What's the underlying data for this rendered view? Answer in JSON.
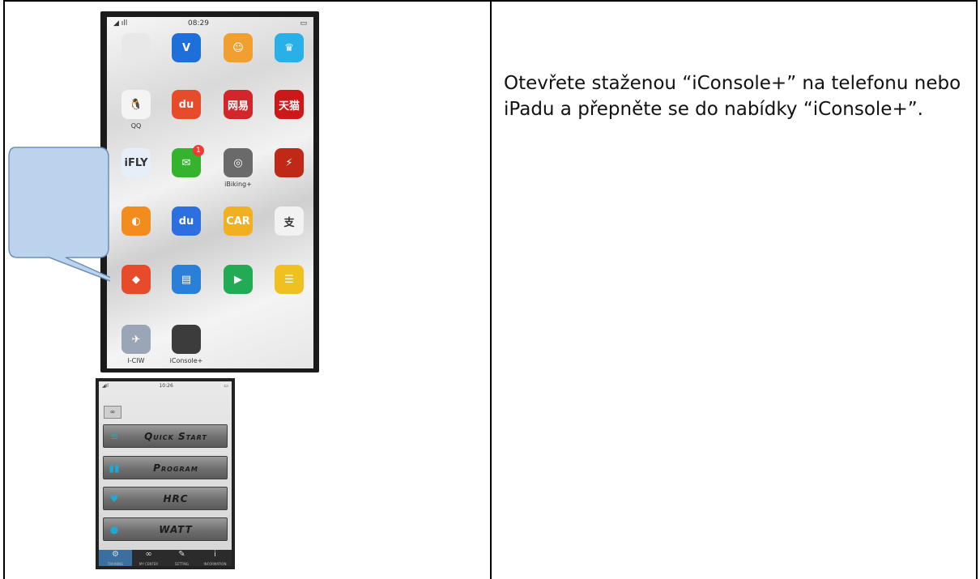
{
  "instruction": "Otevřete staženou “iConsole+” na telefonu nebo iPadu a přepněte se do nabídky “iConsole+”.",
  "phone_home": {
    "status_time": "08:29",
    "apps": [
      {
        "label": "",
        "glyph": "",
        "color": "#e8e8e8"
      },
      {
        "label": "",
        "glyph": "V",
        "color": "#1e6fd9"
      },
      {
        "label": "",
        "glyph": "☺",
        "color": "#f0a030"
      },
      {
        "label": "",
        "glyph": "♛",
        "color": "#2ab0e8"
      },
      {
        "label": "QQ",
        "glyph": "🐧",
        "color": "#f4f4f4"
      },
      {
        "label": "",
        "glyph": "du",
        "color": "#e84b2c"
      },
      {
        "label": "",
        "glyph": "网易",
        "color": "#d3262a"
      },
      {
        "label": "",
        "glyph": "天猫",
        "color": "#cc1818"
      },
      {
        "label": "",
        "glyph": "iFLY",
        "color": "#e6eef7"
      },
      {
        "label": "",
        "glyph": "✉",
        "color": "#35b32f"
      },
      {
        "label": "iBiking+",
        "glyph": "◎",
        "color": "#6a6a6a"
      },
      {
        "label": "",
        "glyph": "⚡",
        "color": "#c02818"
      },
      {
        "label": "",
        "glyph": "◐",
        "color": "#f28c1e"
      },
      {
        "label": "",
        "glyph": "du",
        "color": "#2d6fe0"
      },
      {
        "label": "",
        "glyph": "CAR",
        "color": "#f0b020"
      },
      {
        "label": "",
        "glyph": "支",
        "color": "#f2f2f2"
      },
      {
        "label": "",
        "glyph": "◆",
        "color": "#e84b2c"
      },
      {
        "label": "",
        "glyph": "▤",
        "color": "#2a7fd6"
      },
      {
        "label": "",
        "glyph": "▶",
        "color": "#22aa55"
      },
      {
        "label": "",
        "glyph": "☰",
        "color": "#f0c020"
      },
      {
        "label": "I-CIW",
        "glyph": "✈",
        "color": "#9aa6b5"
      },
      {
        "label": "iConsole+",
        "glyph": "",
        "color": "#3c3c3c"
      }
    ],
    "badge": "1"
  },
  "phone_console": {
    "status_time": "10:26",
    "menu": [
      {
        "icon": "≡",
        "label": "Quick Start"
      },
      {
        "icon": "▮▮",
        "label": "Program"
      },
      {
        "icon": "♥",
        "label": "HRC"
      },
      {
        "icon": "●",
        "label": "WATT"
      }
    ],
    "tabs": [
      {
        "icon": "⚙",
        "label": "TRAINING"
      },
      {
        "icon": "∞",
        "label": "MY CENTER"
      },
      {
        "icon": "✎",
        "label": "SETTING"
      },
      {
        "icon": "i",
        "label": "INFORMATION"
      }
    ]
  }
}
